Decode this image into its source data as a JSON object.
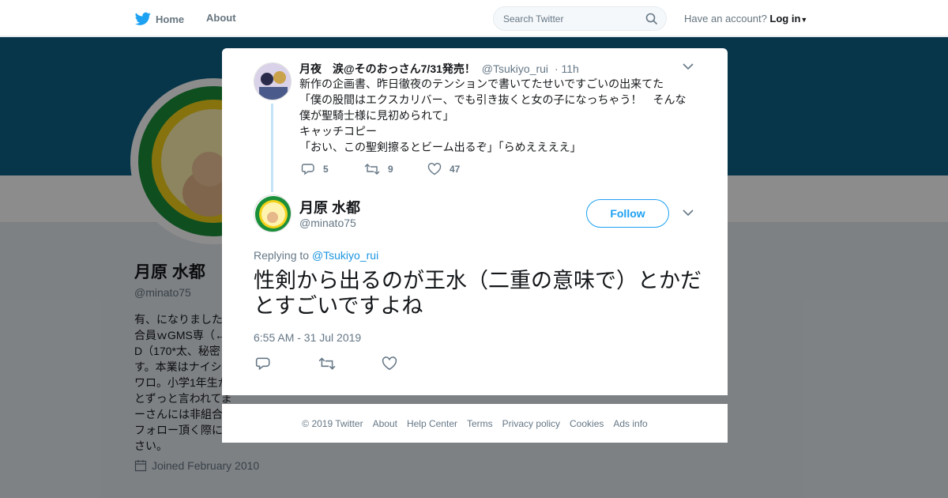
{
  "nav": {
    "home": "Home",
    "about": "About",
    "search_placeholder": "Search Twitter",
    "account_q": "Have an account?",
    "login": "Log in"
  },
  "profile": {
    "name": "月原 水都",
    "handle": "@minato75",
    "bio": "有、になりました\n合員ｗGMS専（←\nD（170*太、秘密\nす。本業はナイシ\nワロ。小学1年生か\nとずっと言われてま\nーさんには非組合\nフォロー頂く際に\nさい。",
    "joined": "Joined February 2010"
  },
  "parent_tweet": {
    "name": "月夜　涙@そのおっさん7/31発売！",
    "handle": "@Tsukiyo_rui",
    "time": "· 11h",
    "text": "新作の企画書、昨日徹夜のテンションで書いてたせいですごいの出来てた\n「僕の股間はエクスカリバー、でも引き抜くと女の子になっちゃう！　そんな僕が聖騎士様に見初められて」\nキャッチコピー\n「おい、この聖剣擦るとビーム出るぞ」「らめええええ」",
    "replies": "5",
    "retweets": "9",
    "likes": "47"
  },
  "main_tweet": {
    "name": "月原 水都",
    "handle": "@minato75",
    "follow": "Follow",
    "replying_label": "Replying to",
    "replying_to": "@Tsukiyo_rui",
    "text": "性剣から出るのが王水（二重の意味で）とかだとすごいですよね",
    "timestamp": "6:55 AM - 31 Jul 2019"
  },
  "footer": [
    "© 2019 Twitter",
    "About",
    "Help Center",
    "Terms",
    "Privacy policy",
    "Cookies",
    "Ads info"
  ],
  "colors": {
    "brand": "#1da1f2",
    "banner": "#0e6286"
  }
}
